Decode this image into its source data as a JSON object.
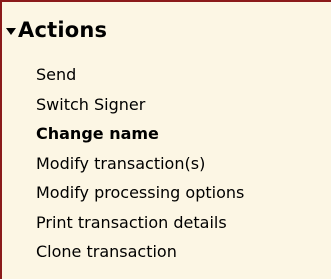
{
  "actions_panel": {
    "title": "Actions",
    "collapse_icon": "triangle-down-icon",
    "colors": {
      "background": "#fcf6e4",
      "border": "#8b1a1a",
      "text": "#000000"
    },
    "items": [
      {
        "label": "Send",
        "bold": false
      },
      {
        "label": "Switch Signer",
        "bold": false
      },
      {
        "label": "Change name",
        "bold": true
      },
      {
        "label": "Modify transaction(s)",
        "bold": false
      },
      {
        "label": "Modify processing options",
        "bold": false
      },
      {
        "label": "Print transaction details",
        "bold": false
      },
      {
        "label": "Clone transaction",
        "bold": false
      }
    ]
  }
}
